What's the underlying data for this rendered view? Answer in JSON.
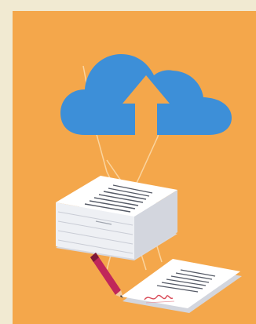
{
  "scene": {
    "cloud_icon": "cloud-upload-icon",
    "arrow_icon": "arrow-up-icon",
    "documents_icon": "paper-stack-icon",
    "signed_page_icon": "signed-document-icon",
    "pen_icon": "pen-icon",
    "signature_icon": "signature-icon"
  },
  "colors": {
    "page_background": "#f1ead2",
    "panel_background": "#f4a74b",
    "cloud": "#3d8fd8",
    "arrow": "#f4a74b",
    "paper": "#ffffff",
    "paper_shadow": "#d8dbe2",
    "pen": "#c0275a",
    "signature": "#d84a58"
  }
}
